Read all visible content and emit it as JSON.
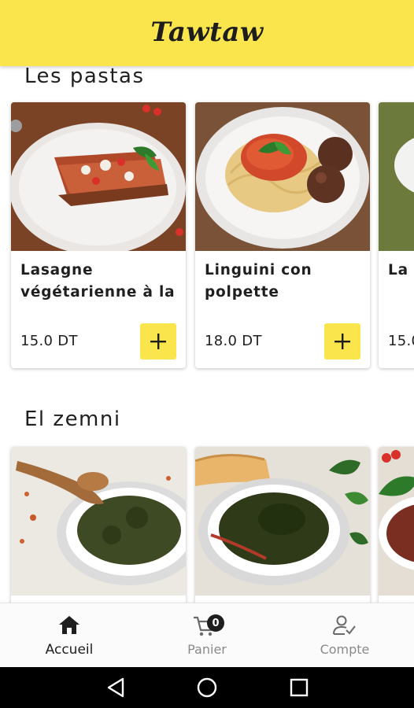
{
  "app": {
    "logo_text": "Tawtaw"
  },
  "sections": [
    {
      "title": "Les pastas",
      "items": [
        {
          "name": "Lasagne\nvégétarienne à la",
          "price": "15.0 DT"
        },
        {
          "name": "Linguini con\npolpette",
          "price": "18.0 DT"
        },
        {
          "name": "La",
          "price": "15.0"
        }
      ]
    },
    {
      "title": "El zemni",
      "items": []
    }
  ],
  "bottom_nav": {
    "home_label": "Accueil",
    "cart_label": "Panier",
    "cart_count": "0",
    "account_label": "Compte"
  },
  "colors": {
    "brand_yellow": "#fbe54c",
    "active": "#1e1e1e",
    "inactive": "#8a8a8a"
  }
}
